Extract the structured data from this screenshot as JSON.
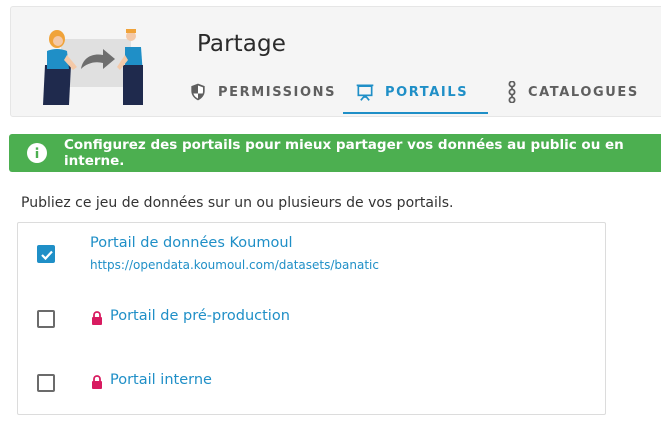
{
  "header": {
    "title": "Partage",
    "tabs": [
      {
        "label": "PERMISSIONS",
        "icon": "shield-icon",
        "active": false
      },
      {
        "label": "PORTAILS",
        "icon": "presentation-board-icon",
        "active": true
      },
      {
        "label": "CATALOGUES",
        "icon": "dots-vertical-icon",
        "active": false
      }
    ]
  },
  "alert": {
    "icon": "info-circle-icon",
    "text": "Configurez des portails pour mieux partager vos données au public ou en interne.",
    "color": "#4caf50"
  },
  "intro_text": "Publiez ce jeu de données sur un ou plusieurs de vos portails.",
  "portals": [
    {
      "name": "Portail de données Koumoul",
      "url": "https://opendata.koumoul.com/datasets/banatic",
      "checked": true,
      "locked": false
    },
    {
      "name": "Portail de pré-production",
      "url": "",
      "checked": false,
      "locked": true
    },
    {
      "name": "Portail interne",
      "url": "",
      "checked": false,
      "locked": true
    }
  ],
  "colors": {
    "accent": "#1f8fc7",
    "lock": "#d81b60",
    "tab_inactive": "#5f5f5f"
  }
}
